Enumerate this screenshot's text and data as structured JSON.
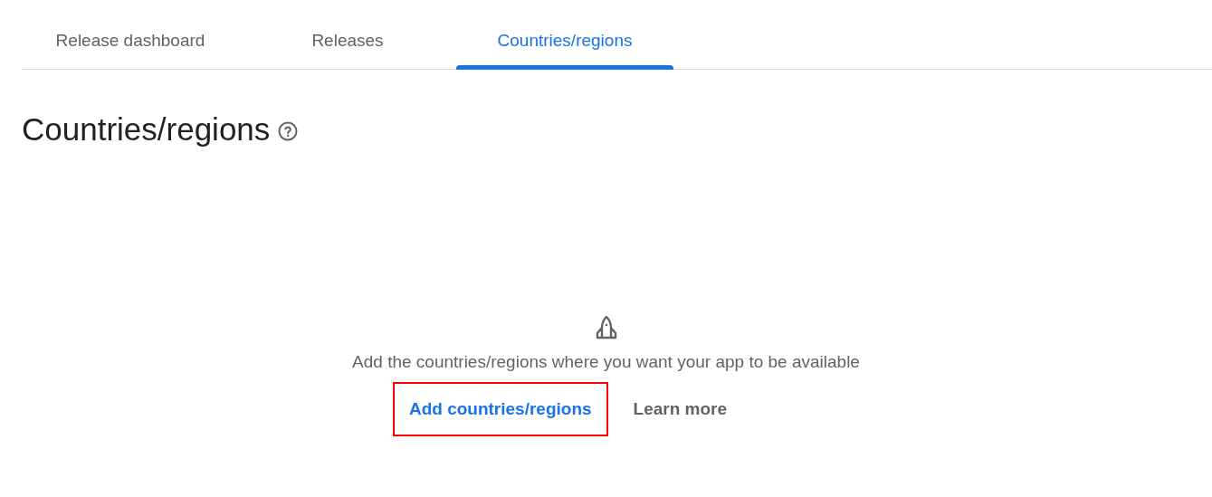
{
  "tabs": [
    {
      "label": "Release dashboard",
      "selected": false
    },
    {
      "label": "Releases",
      "selected": false
    },
    {
      "label": "Countries/regions",
      "selected": true
    }
  ],
  "page_title": "Countries/regions",
  "empty_state": {
    "message": "Add the countries/regions where you want your app to be available",
    "actions": [
      {
        "label": "Add countries/regions",
        "kind": "primary",
        "highlighted": true
      },
      {
        "label": "Learn more",
        "kind": "secondary",
        "highlighted": false
      }
    ]
  }
}
